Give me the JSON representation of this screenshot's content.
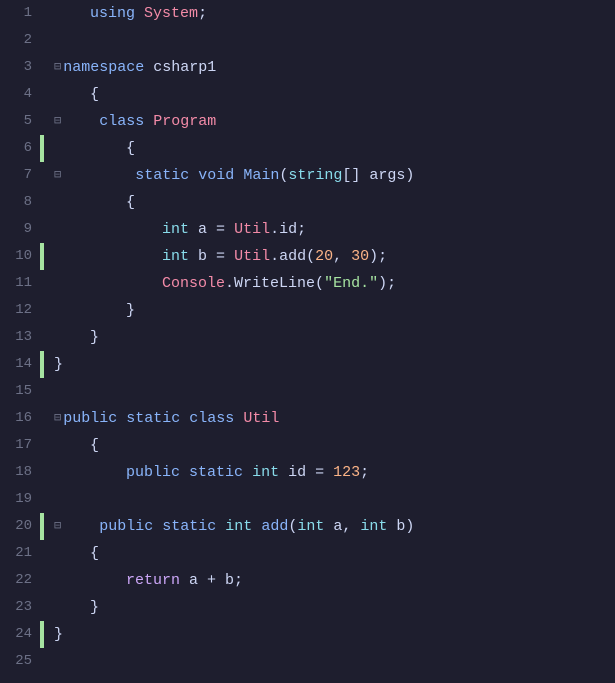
{
  "editor": {
    "background": "#1e1e2e",
    "lines": [
      {
        "num": 1,
        "git": "",
        "indent": 0,
        "tokens": [
          {
            "t": "    ",
            "c": "plain"
          },
          {
            "t": "using",
            "c": "kw"
          },
          {
            "t": " ",
            "c": "plain"
          },
          {
            "t": "System",
            "c": "class-name"
          },
          {
            "t": ";",
            "c": "plain"
          }
        ]
      },
      {
        "num": 2,
        "git": "",
        "indent": 0,
        "tokens": []
      },
      {
        "num": 3,
        "git": "",
        "indent": 0,
        "tokens": [
          {
            "t": "⊟",
            "c": "collapse-icon"
          },
          {
            "t": "namespace",
            "c": "kw"
          },
          {
            "t": " csharp1",
            "c": "namespace-name"
          }
        ]
      },
      {
        "num": 4,
        "git": "",
        "indent": 0,
        "tokens": [
          {
            "t": "    {",
            "c": "plain"
          }
        ]
      },
      {
        "num": 5,
        "git": "",
        "indent": 1,
        "tokens": [
          {
            "t": "⊟",
            "c": "collapse-icon"
          },
          {
            "t": "    class",
            "c": "kw"
          },
          {
            "t": " ",
            "c": "plain"
          },
          {
            "t": "Program",
            "c": "class-name"
          }
        ]
      },
      {
        "num": 6,
        "git": "green",
        "indent": 1,
        "tokens": [
          {
            "t": "        {",
            "c": "plain"
          }
        ]
      },
      {
        "num": 7,
        "git": "",
        "indent": 2,
        "tokens": [
          {
            "t": "⊟",
            "c": "collapse-icon"
          },
          {
            "t": "        static",
            "c": "kw"
          },
          {
            "t": " ",
            "c": "plain"
          },
          {
            "t": "void",
            "c": "kw"
          },
          {
            "t": " ",
            "c": "plain"
          },
          {
            "t": "Main",
            "c": "method"
          },
          {
            "t": "(",
            "c": "plain"
          },
          {
            "t": "string",
            "c": "kw-type"
          },
          {
            "t": "[] args)",
            "c": "plain"
          }
        ]
      },
      {
        "num": 8,
        "git": "",
        "indent": 2,
        "tokens": [
          {
            "t": "        {",
            "c": "plain"
          }
        ]
      },
      {
        "num": 9,
        "git": "",
        "indent": 3,
        "tokens": [
          {
            "t": "            ",
            "c": "plain"
          },
          {
            "t": "int",
            "c": "kw-type"
          },
          {
            "t": " a = ",
            "c": "plain"
          },
          {
            "t": "Util",
            "c": "class-name"
          },
          {
            "t": ".id;",
            "c": "plain"
          }
        ]
      },
      {
        "num": 10,
        "git": "green",
        "indent": 3,
        "tokens": [
          {
            "t": "            ",
            "c": "plain"
          },
          {
            "t": "int",
            "c": "kw-type"
          },
          {
            "t": " b = ",
            "c": "plain"
          },
          {
            "t": "Util",
            "c": "class-name"
          },
          {
            "t": ".add(",
            "c": "plain"
          },
          {
            "t": "20",
            "c": "number"
          },
          {
            "t": ", ",
            "c": "plain"
          },
          {
            "t": "30",
            "c": "number"
          },
          {
            "t": ");",
            "c": "plain"
          }
        ]
      },
      {
        "num": 11,
        "git": "",
        "indent": 3,
        "tokens": [
          {
            "t": "            ",
            "c": "plain"
          },
          {
            "t": "Console",
            "c": "class-name"
          },
          {
            "t": ".WriteLine(",
            "c": "plain"
          },
          {
            "t": "\"End.\"",
            "c": "string"
          },
          {
            "t": ");",
            "c": "plain"
          }
        ]
      },
      {
        "num": 12,
        "git": "",
        "indent": 2,
        "tokens": [
          {
            "t": "        }",
            "c": "plain"
          }
        ]
      },
      {
        "num": 13,
        "git": "",
        "indent": 1,
        "tokens": [
          {
            "t": "    }",
            "c": "plain"
          }
        ]
      },
      {
        "num": 14,
        "git": "green",
        "indent": 0,
        "tokens": [
          {
            "t": "}",
            "c": "plain"
          }
        ]
      },
      {
        "num": 15,
        "git": "",
        "indent": 0,
        "tokens": []
      },
      {
        "num": 16,
        "git": "",
        "indent": 0,
        "tokens": [
          {
            "t": "⊟",
            "c": "collapse-icon"
          },
          {
            "t": "public",
            "c": "kw"
          },
          {
            "t": " ",
            "c": "plain"
          },
          {
            "t": "static",
            "c": "kw"
          },
          {
            "t": " ",
            "c": "plain"
          },
          {
            "t": "class",
            "c": "kw"
          },
          {
            "t": " ",
            "c": "plain"
          },
          {
            "t": "Util",
            "c": "class-name"
          }
        ]
      },
      {
        "num": 17,
        "git": "",
        "indent": 0,
        "tokens": [
          {
            "t": "    {",
            "c": "plain"
          }
        ]
      },
      {
        "num": 18,
        "git": "",
        "indent": 1,
        "tokens": [
          {
            "t": "        ",
            "c": "plain"
          },
          {
            "t": "public",
            "c": "kw"
          },
          {
            "t": " ",
            "c": "plain"
          },
          {
            "t": "static",
            "c": "kw"
          },
          {
            "t": " ",
            "c": "plain"
          },
          {
            "t": "int",
            "c": "kw-type"
          },
          {
            "t": " id = ",
            "c": "plain"
          },
          {
            "t": "123",
            "c": "number"
          },
          {
            "t": ";",
            "c": "plain"
          }
        ]
      },
      {
        "num": 19,
        "git": "",
        "indent": 0,
        "tokens": []
      },
      {
        "num": 20,
        "git": "green",
        "indent": 1,
        "tokens": [
          {
            "t": "⊟",
            "c": "collapse-icon"
          },
          {
            "t": "    public",
            "c": "kw"
          },
          {
            "t": " ",
            "c": "plain"
          },
          {
            "t": "static",
            "c": "kw"
          },
          {
            "t": " ",
            "c": "plain"
          },
          {
            "t": "int",
            "c": "kw-type"
          },
          {
            "t": " ",
            "c": "plain"
          },
          {
            "t": "add",
            "c": "method"
          },
          {
            "t": "(",
            "c": "plain"
          },
          {
            "t": "int",
            "c": "kw-type"
          },
          {
            "t": " a, ",
            "c": "plain"
          },
          {
            "t": "int",
            "c": "kw-type"
          },
          {
            "t": " b)",
            "c": "plain"
          }
        ]
      },
      {
        "num": 21,
        "git": "",
        "indent": 1,
        "tokens": [
          {
            "t": "    {",
            "c": "plain"
          }
        ]
      },
      {
        "num": 22,
        "git": "",
        "indent": 2,
        "tokens": [
          {
            "t": "        ",
            "c": "plain"
          },
          {
            "t": "return",
            "c": "kw-control"
          },
          {
            "t": " a + b;",
            "c": "plain"
          }
        ]
      },
      {
        "num": 23,
        "git": "",
        "indent": 1,
        "tokens": [
          {
            "t": "    }",
            "c": "plain"
          }
        ]
      },
      {
        "num": 24,
        "git": "green",
        "indent": 0,
        "tokens": [
          {
            "t": "}",
            "c": "plain"
          }
        ]
      },
      {
        "num": 25,
        "git": "",
        "indent": 0,
        "tokens": []
      }
    ]
  }
}
